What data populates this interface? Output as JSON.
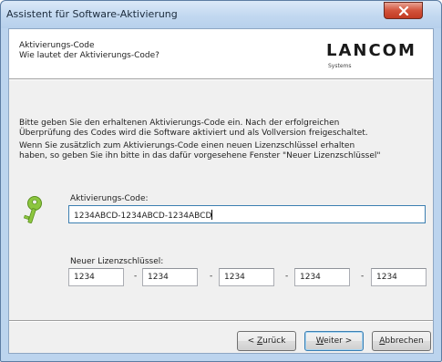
{
  "window": {
    "title": "Assistent für Software-Aktivierung"
  },
  "header": {
    "title": "Aktivierungs-Code",
    "subtitle": "Wie lautet der Aktivierungs-Code?",
    "logo_main": "LANCOM",
    "logo_sub": "Systems"
  },
  "body": {
    "para1_line1": "Bitte geben Sie den erhaltenen Aktivierungs-Code ein. Nach der erfolgreichen",
    "para1_line2": "Überprüfung des Codes wird die Software aktiviert und als Vollversion freigeschaltet.",
    "para2_line1": "Wenn Sie zusätzlich zum Aktivierungs-Code einen neuen Lizenzschlüssel erhalten",
    "para2_line2": "haben, so geben Sie ihn bitte in das dafür vorgesehene Fenster \"Neuer Lizenzschlüssel\"",
    "activation_label": "Aktivierungs-Code:",
    "activation_value": "1234ABCD-1234ABCD-1234ABCD",
    "license_label": "Neuer Lizenzschlüssel:",
    "license_parts": [
      "1234",
      "1234",
      "1234",
      "1234",
      "1234"
    ],
    "separator": "-"
  },
  "buttons": {
    "back_prefix": "< ",
    "back_mnemonic": "Z",
    "back_rest": "urück",
    "next_mnemonic": "W",
    "next_rest": "eiter >",
    "cancel_mnemonic": "A",
    "cancel_rest": "bbrechen"
  },
  "icons": {
    "key": "key-icon",
    "close": "close-icon"
  },
  "colors": {
    "key": "#8cc63f",
    "close_button": "#d2533b"
  }
}
